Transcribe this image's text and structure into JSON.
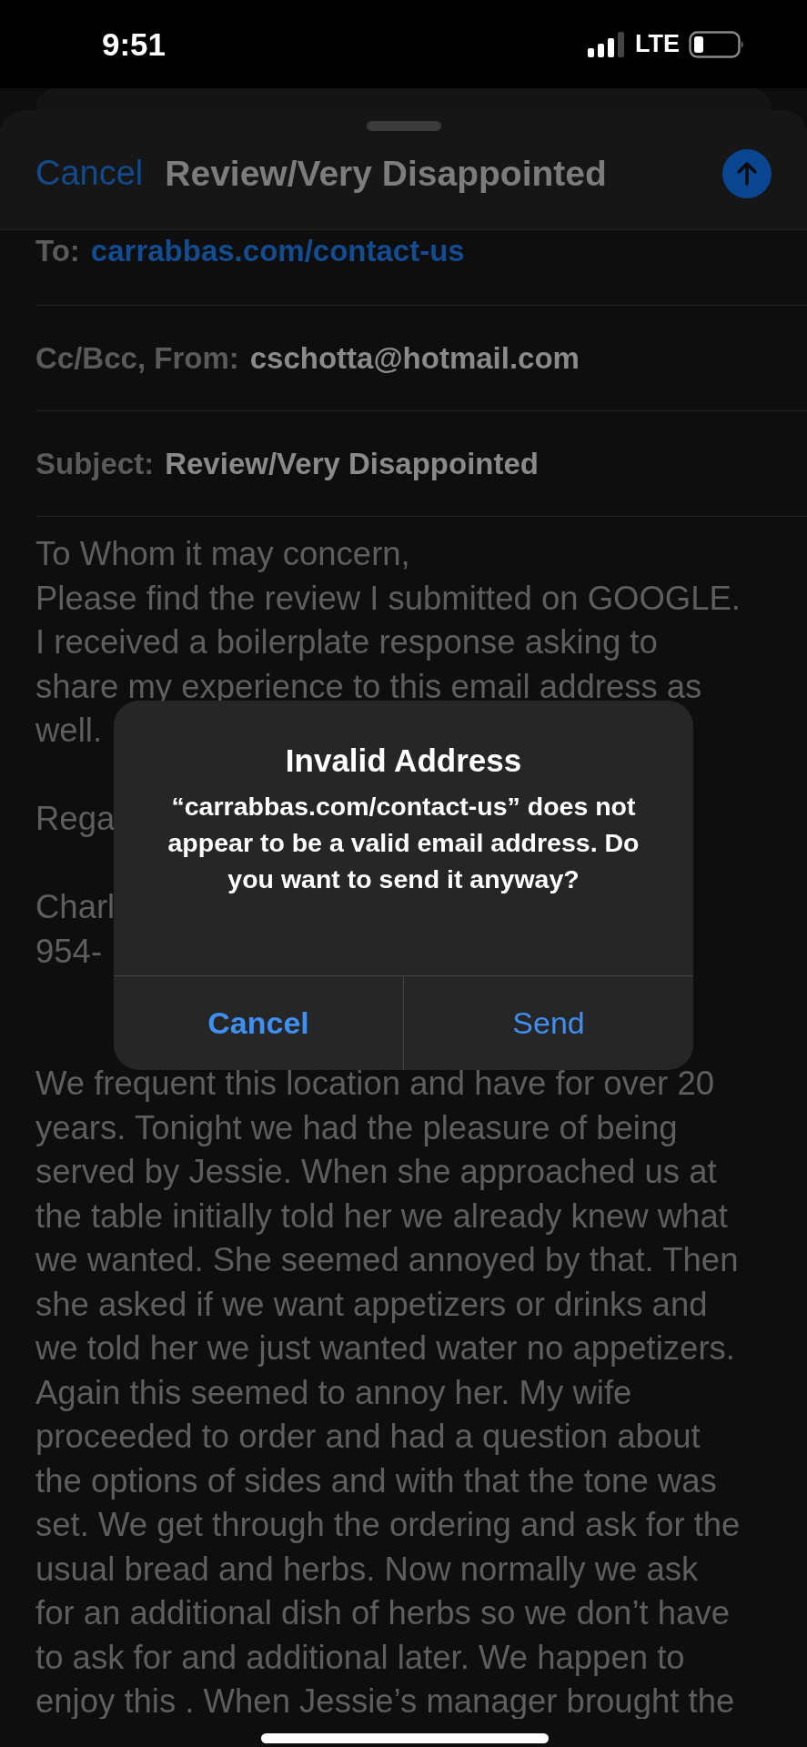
{
  "status_bar": {
    "time": "9:51",
    "network": "LTE"
  },
  "compose": {
    "cancel": "Cancel",
    "title": "Review/Very Disappointed",
    "fields": [
      {
        "label": "To:",
        "value": "carrabbas.com/contact-us",
        "kind": "link"
      },
      {
        "label": "Cc/Bcc, From:",
        "value": "cschotta@hotmail.com",
        "kind": "plain"
      },
      {
        "label": "Subject:",
        "value": "Review/Very Disappointed",
        "kind": "plain"
      }
    ],
    "body": [
      [
        "To Whom it may concern,",
        "Please find the review I submitted on GOOGLE.",
        "I received a boilerplate response asking to",
        "share my experience to this email address as",
        "well."
      ],
      [
        "Rega"
      ],
      [
        "Charl",
        "954-"
      ],
      [
        "We frequent this location and have for over 20",
        "years. Tonight we had the pleasure of being",
        "served by Jessie. When she approached us at",
        "the table initially told her we already knew what",
        "we wanted. She seemed annoyed by that. Then",
        "she asked if we want appetizers or drinks and",
        "we told her we just wanted water no appetizers.",
        "Again this seemed to annoy her. My wife",
        "proceeded to order and had a question about",
        "the options of sides and with that the tone was",
        "set. We get through the ordering and ask for the",
        "usual bread and herbs. Now normally we ask",
        "for an additional dish of herbs so we don’t have",
        "to ask for and additional later. We happen to",
        "enjoy this . When Jessie’s manager brought the"
      ]
    ]
  },
  "alert": {
    "title": "Invalid Address",
    "message": "“carrabbas.com/contact-us” does not appear to be a valid email address. Do you want to send it anyway?",
    "buttons": [
      {
        "label": "Cancel",
        "preferred": true
      },
      {
        "label": "Send",
        "preferred": false
      }
    ]
  }
}
